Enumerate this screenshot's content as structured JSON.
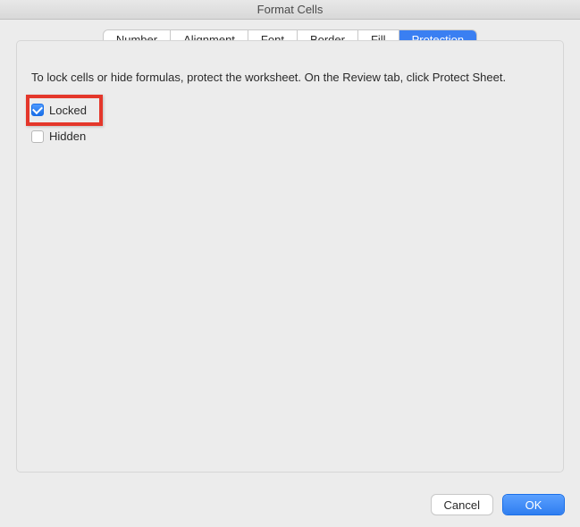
{
  "window": {
    "title": "Format Cells"
  },
  "tabs": {
    "number": "Number",
    "alignment": "Alignment",
    "font": "Font",
    "border": "Border",
    "fill": "Fill",
    "protection": "Protection",
    "active": "protection"
  },
  "protection": {
    "description": "To lock cells or hide formulas, protect the worksheet. On the Review tab, click Protect Sheet.",
    "locked_label": "Locked",
    "locked_checked": true,
    "hidden_label": "Hidden",
    "hidden_checked": false
  },
  "buttons": {
    "cancel": "Cancel",
    "ok": "OK"
  },
  "annotation": {
    "highlight_target": "locked-checkbox"
  }
}
